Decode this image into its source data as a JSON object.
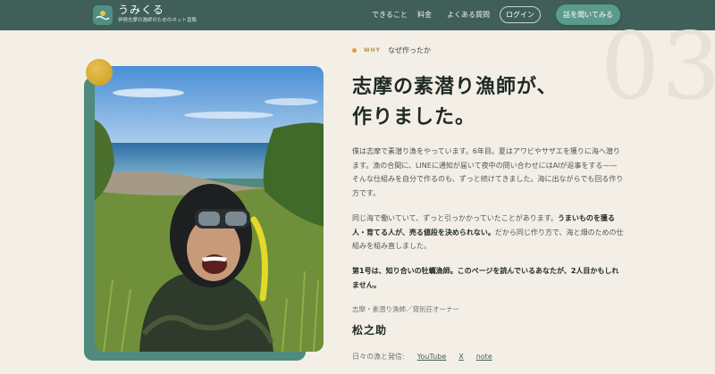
{
  "header": {
    "brand_name": "うみくる",
    "brand_tagline": "伊勢志摩の漁師のためのネット直販",
    "nav": [
      "できること",
      "料金",
      "よくある質問"
    ],
    "login_label": "ログイン",
    "cta_label": "話を聞いてみる"
  },
  "section": {
    "number": "03",
    "eyebrow_en": "WHY",
    "eyebrow_jp": "なぜ作ったか",
    "headline_line1": "志摩の素潜り漁師が、",
    "headline_line2": "作りました。",
    "p1": "僕は志摩で素潜り漁をやっています。6年目。夏はアワビやサザエを獲りに海へ潜ります。漁の合間に、LINEに通知が届いて夜中の問い合わせにはAIが返事をする——そんな仕組みを自分で作るのも、ずっと続けてきました。海に出ながらでも回る作り方です。",
    "p2_before": "同じ海で働いていて、ずっと引っかかっていたことがあります。",
    "p2_bold": "うまいものを獲る人・育てる人が、売る値段を決められない。",
    "p2_after": "だから同じ作り方で、海と畑のための仕組みを組み直しました。",
    "p3": "第1号は、知り合いの牡蠣漁師。このページを読んでいるあなたが、2人目かもしれません。",
    "role": "志摩・素潜り漁師／貸別荘オーナー",
    "signature": "松之助",
    "links_label": "日々の漁と発信:",
    "links": [
      "YouTube",
      "X",
      "note"
    ]
  },
  "colors": {
    "header_bg": "#3f5f58",
    "accent_green": "#5c9a8c",
    "accent_gold": "#d6a437",
    "page_bg": "#f4efe6"
  },
  "icons": {
    "logo": "wave-sun-icon"
  }
}
